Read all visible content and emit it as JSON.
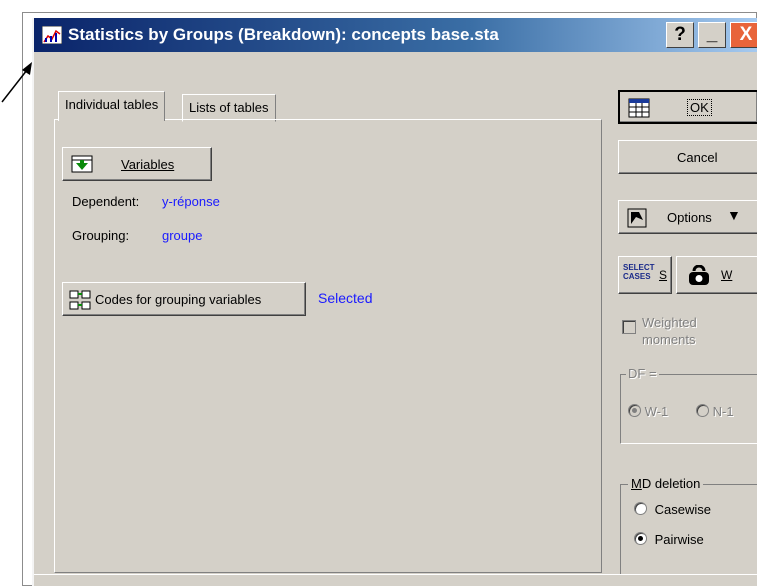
{
  "window": {
    "title": "Statistics by Groups (Breakdown): concepts base.sta",
    "help_btn": "?",
    "min_btn": "_",
    "close_btn": "X"
  },
  "tabs": [
    {
      "label": "Individual tables"
    },
    {
      "label": "Lists of tables"
    }
  ],
  "variables_button": {
    "label": "Variables",
    "icon": "variables-icon"
  },
  "dependent": {
    "label": "Dependent:",
    "value": "y-réponse"
  },
  "grouping": {
    "label": "Grouping:",
    "value": "groupe"
  },
  "codes_button": {
    "label": "Codes for grouping variables",
    "icon": "codes-icon"
  },
  "codes_status": "Selected",
  "side": {
    "ok": "OK",
    "cancel": "Cancel",
    "options": "Options",
    "select_cases": {
      "icon_text_1": "SELECT",
      "icon_text_2": "CASES",
      "key": "S"
    },
    "weight": {
      "key": "W"
    },
    "weighted_moments": "Weighted moments",
    "df_label": "DF =",
    "df_options": [
      "W-1",
      "N-1"
    ],
    "md_deletion": {
      "label": "MD deletion",
      "options": [
        "Casewise",
        "Pairwise"
      ],
      "selected": "Pairwise"
    }
  },
  "colors": {
    "titlebar": "#0a246a",
    "dialog": "#d4d0c8",
    "link_blue": "#1a1aff"
  }
}
